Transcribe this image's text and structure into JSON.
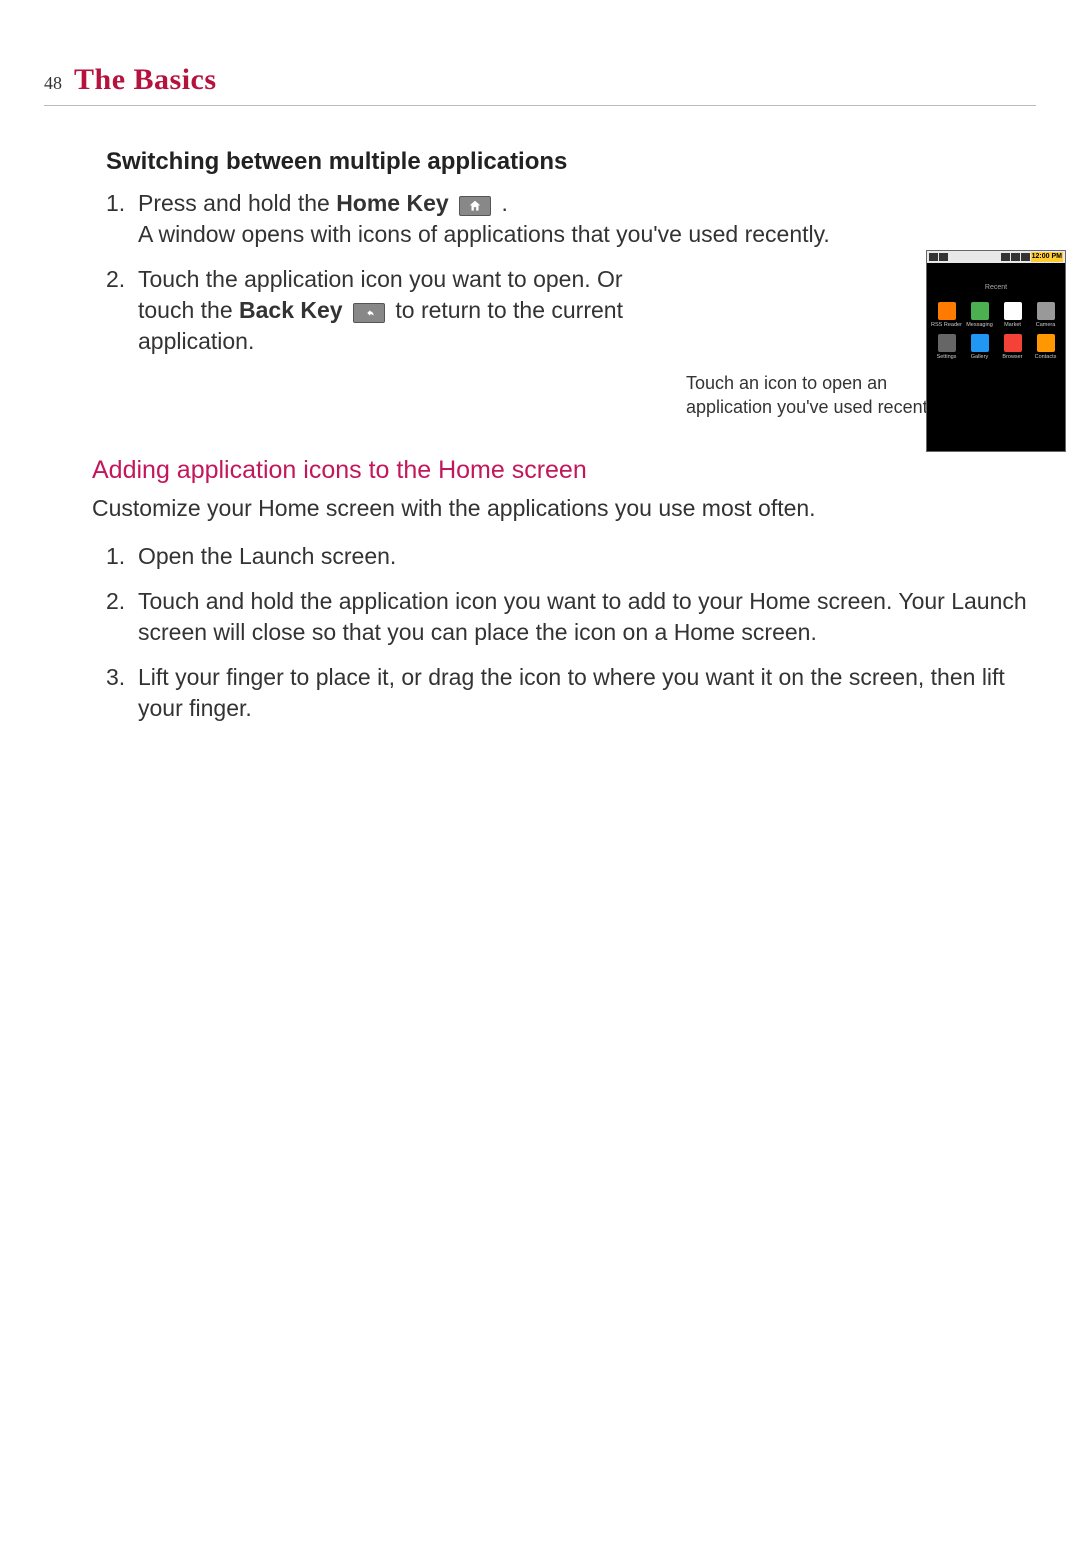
{
  "header": {
    "page_number": "48",
    "chapter": "The Basics"
  },
  "section1": {
    "heading": "Switching between multiple applications",
    "step1_prefix": "Press and hold the ",
    "step1_key": "Home Key",
    "step1_suffix": " .",
    "step1_line2": "A window opens with icons of applications that you've used recently.",
    "step2_prefix": "Touch the application icon you want to open. Or touch the ",
    "step2_key": "Back Key",
    "step2_suffix": " to return to the current application.",
    "callout": "Touch an icon to open an application you've used recently."
  },
  "section2": {
    "heading": "Adding application icons to the Home screen",
    "intro": "Customize your Home screen with the applications you use most often.",
    "step1": "Open the Launch screen.",
    "step2": "Touch and hold the application icon you want to add to your Home screen. Your Launch screen will close so that you can place the icon on a Home screen.",
    "step3": "Lift your finger to place it, or drag the icon to where you want it on the screen, then lift your finger."
  },
  "phone": {
    "time": "12:00 PM",
    "recent_label": "Recent",
    "apps": [
      {
        "label": "RSS Reader",
        "cls": "ic-rss"
      },
      {
        "label": "Messaging",
        "cls": "ic-msg"
      },
      {
        "label": "Market",
        "cls": "ic-market"
      },
      {
        "label": "Camera",
        "cls": "ic-camera"
      },
      {
        "label": "Settings",
        "cls": "ic-settings"
      },
      {
        "label": "Gallery",
        "cls": "ic-gallery"
      },
      {
        "label": "Browser",
        "cls": "ic-browser"
      },
      {
        "label": "Contacts",
        "cls": "ic-contacts"
      }
    ]
  },
  "numbers": {
    "n1": "1.",
    "n2": "2.",
    "n3": "3."
  }
}
